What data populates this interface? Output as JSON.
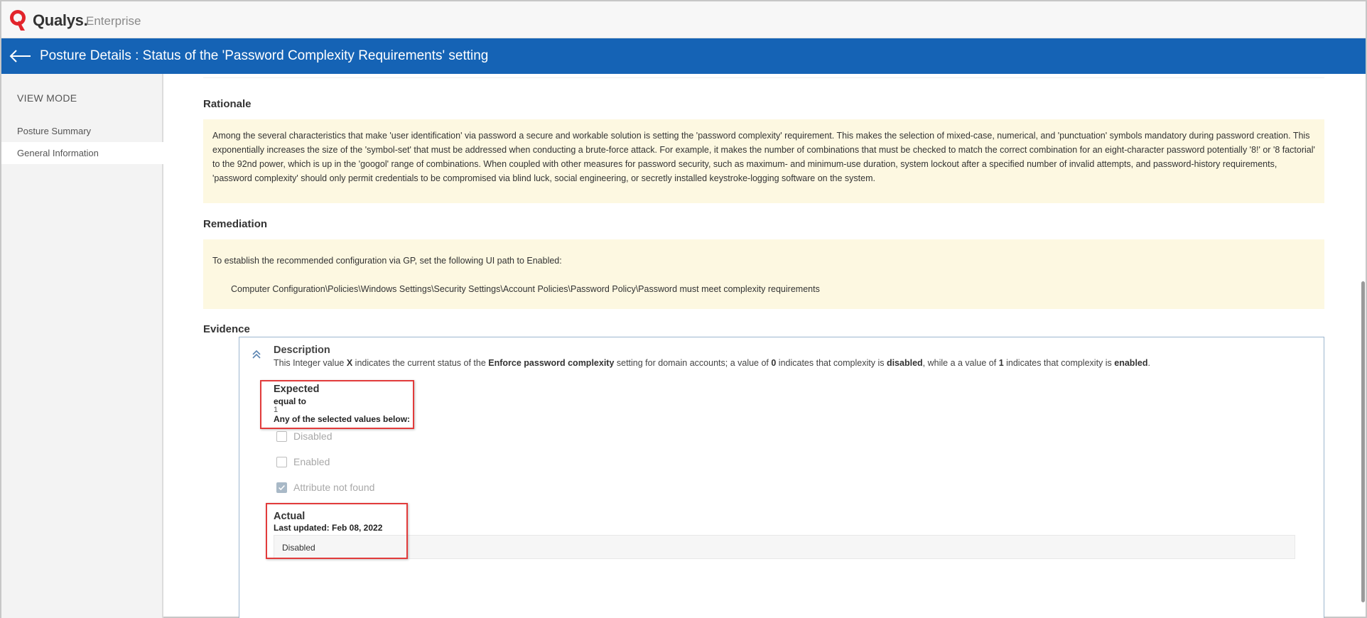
{
  "app": {
    "brand": "Qualys.",
    "edition": "Enterprise"
  },
  "header": {
    "title": "Posture Details : Status of the 'Password Complexity Requirements' setting"
  },
  "sidebar": {
    "heading": "VIEW MODE",
    "items": [
      {
        "label": "Posture Summary"
      },
      {
        "label": "General Information"
      }
    ]
  },
  "rationale": {
    "title": "Rationale",
    "text": "Among the several characteristics that make 'user identification' via password a secure and workable solution is setting the 'password complexity' requirement.  This makes the selection of mixed-case, numerical, and 'punctuation' symbols mandatory during password creation.  This exponentially increases the size of the 'symbol-set' that must be addressed when conducting a brute-force attack.  For example, it makes the number of combinations that must be checked to match the correct combination for an eight-character password potentially '8!' or '8 factorial' to the 92nd power, which is up in the 'googol' range of combinations.  When coupled with other measures for password security, such as maximum- and minimum-use duration, system lockout after a specified number of invalid attempts, and password-history requirements, 'password complexity' should only permit credentials to be compromised via blind luck, social engineering, or secretly installed keystroke-logging software on the system."
  },
  "remediation": {
    "title": "Remediation",
    "line1": "To establish the recommended configuration via GP, set the following UI path to Enabled:",
    "path": "Computer Configuration\\Policies\\Windows Settings\\Security Settings\\Account Policies\\Password Policy\\Password must meet complexity requirements"
  },
  "evidence": {
    "title": "Evidence",
    "description": {
      "title": "Description",
      "t1": "This Integer value ",
      "b1": "X",
      "t2": " indicates the current status of the ",
      "b2": "Enforce password complexity",
      "t3": " setting for domain accounts; a value of ",
      "b3": "0",
      "t4": " indicates that complexity is ",
      "b4": "disabled",
      "t5": ", while a a value of ",
      "b5": "1",
      "t6": " indicates that complexity is ",
      "b6": "enabled",
      "t7": "."
    },
    "expected": {
      "title": "Expected",
      "operator": "equal to",
      "value": "1",
      "any_label": "Any of the selected values below:",
      "options": [
        {
          "label": "Disabled",
          "checked": false
        },
        {
          "label": "Enabled",
          "checked": false
        },
        {
          "label": "Attribute not found",
          "checked": true
        }
      ]
    },
    "actual": {
      "title": "Actual",
      "last_updated": "Last updated: Feb 08, 2022",
      "value": "Disabled"
    }
  },
  "colors": {
    "header_blue": "#1563b5",
    "note_yellow": "#fdf8e1",
    "highlight_red": "#e23b3b"
  }
}
